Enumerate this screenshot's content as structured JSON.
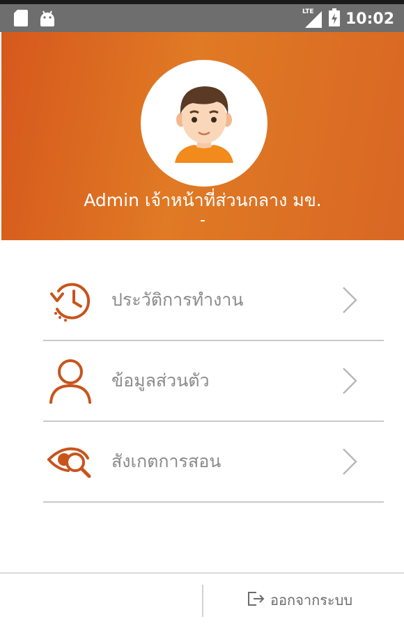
{
  "status_bar": {
    "time": "10:02",
    "network_label": "LTE",
    "icons": [
      "sd-card-icon",
      "android-icon",
      "signal-icon",
      "battery-charging-icon"
    ]
  },
  "profile": {
    "name": "Admin เจ้าหน้าที่ส่วนกลาง มข.",
    "subtitle": "-"
  },
  "menu": {
    "items": [
      {
        "label": "ประวัติการทำงาน",
        "icon": "history-clock-icon"
      },
      {
        "label": "ข้อมูลส่วนตัว",
        "icon": "person-icon"
      },
      {
        "label": "สังเกตการสอน",
        "icon": "eye-search-icon"
      }
    ]
  },
  "footer": {
    "logout_label": "ออกจากระบบ"
  },
  "colors": {
    "accent": "#e07a24",
    "accent_dark": "#d6581d",
    "icon": "#c8541c",
    "text_muted": "#8a8a8a"
  }
}
